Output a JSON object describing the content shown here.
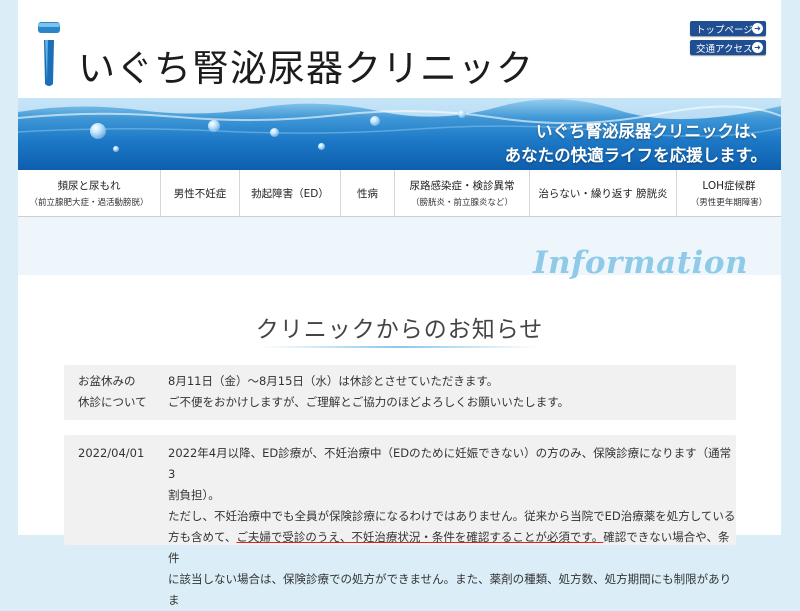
{
  "header": {
    "site_title": "いぐち腎泌尿器クリニック",
    "top_page_label": "トップページ",
    "access_label": "交通アクセス",
    "banner_line1": "いぐち腎泌尿器クリニックは、",
    "banner_line2": "あなたの快適ライフを応援します。"
  },
  "nav": {
    "items": [
      {
        "label": "頻尿と尿もれ",
        "sub": "（前立腺肥大症・過活動膀胱）"
      },
      {
        "label": "男性不妊症",
        "sub": ""
      },
      {
        "label": "勃起障害（ED）",
        "sub": ""
      },
      {
        "label": "性病",
        "sub": ""
      },
      {
        "label": "尿路感染症・検診異常",
        "sub": "（膀胱炎・前立腺炎など）"
      },
      {
        "label": "治らない・繰り返す 膀胱炎",
        "sub": ""
      },
      {
        "label": "LOH症候群",
        "sub": "（男性更年期障害）"
      }
    ]
  },
  "info": {
    "script_heading": "Information",
    "title": "クリニックからのお知らせ"
  },
  "notices": [
    {
      "label_line1": "お盆休みの",
      "label_line2": "休診について",
      "line1": "8月11日（金）～8月15日（水）は休診とさせていただきます。",
      "line2": "ご不便をおかけしますが、ご理解とご協力のほどよろしくお願いいたします。"
    },
    {
      "label": "2022/04/01",
      "line1": "2022年4月以降、ED診療が、不妊治療中（EDのために妊娠できない）の方のみ、保険診療になります（通常3",
      "line2": "割負担）。",
      "line3": "ただし、不妊治療中でも全員が保険診療になるわけではありません。従来から当院でED治療薬を処方している",
      "line4a": "方も含めて、",
      "line4b": "ご夫婦で受診のうえ、不妊治療状況・条件を確認することが必須です。",
      "line4c": "確認できない場合や、条件",
      "line5": "に該当しない場合は、保険診療での処方ができません。また、薬剤の種類、処方数、処方期間にも制限がありま"
    }
  ],
  "colors": {
    "accent_blue": "#1f4e93",
    "notice_red": "#e2231a",
    "page_bg": "#dbeef8"
  }
}
